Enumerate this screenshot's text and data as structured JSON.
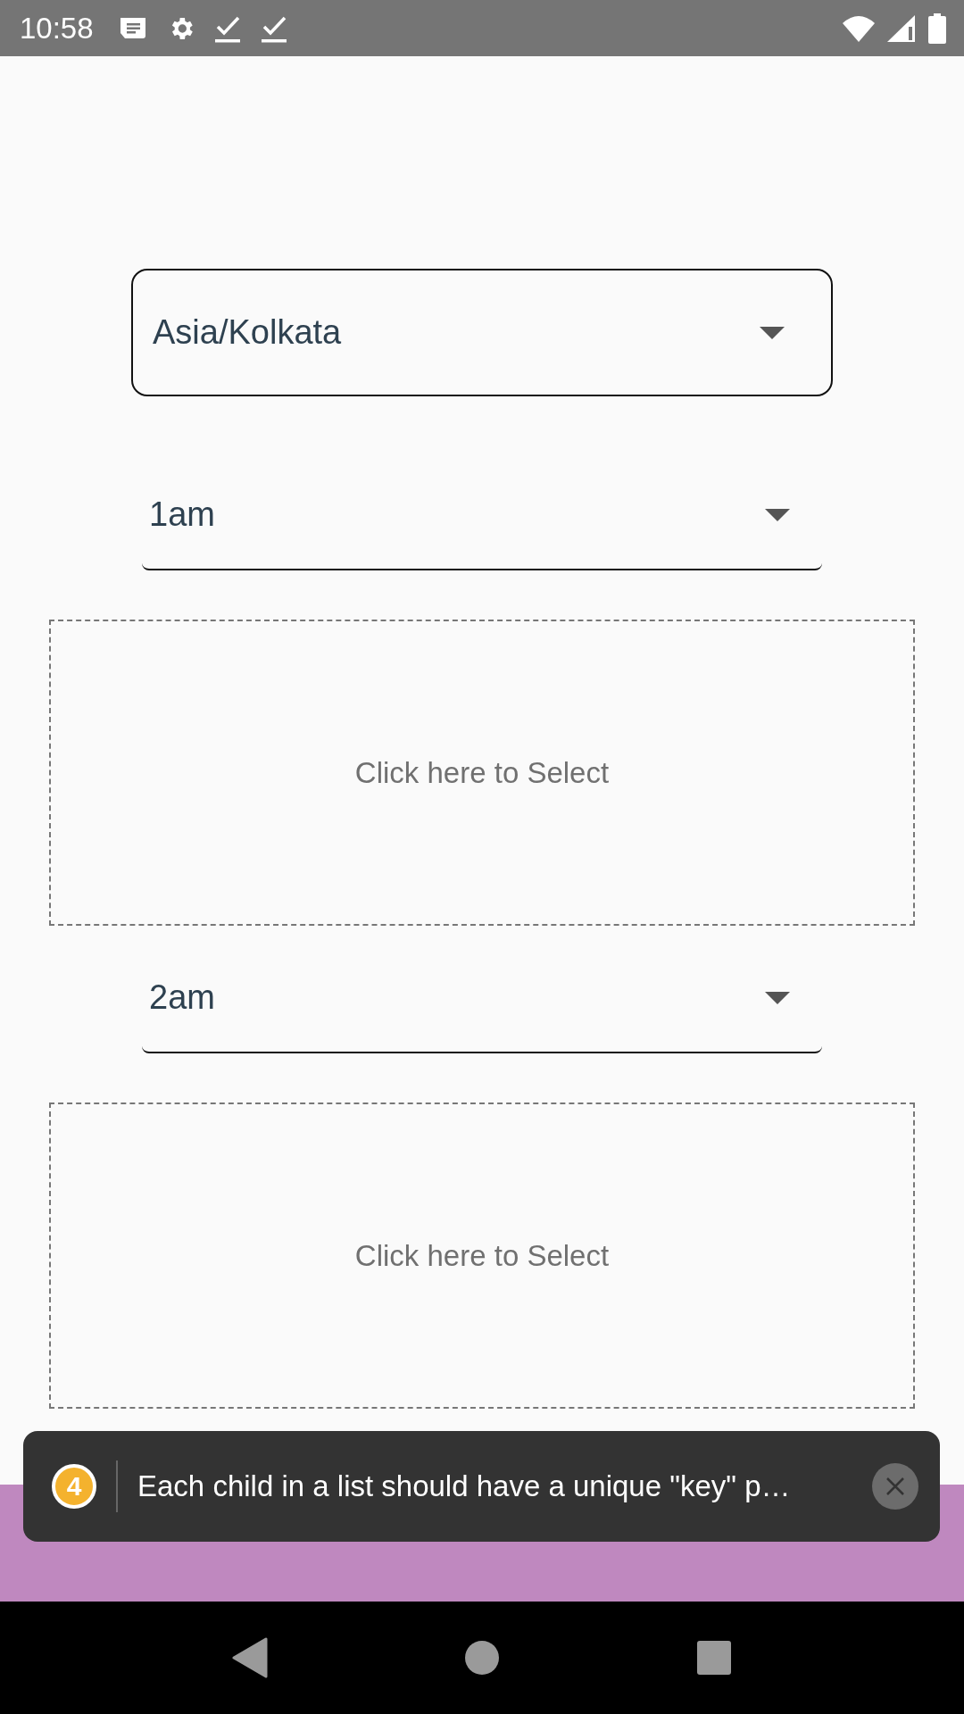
{
  "status_bar": {
    "time": "10:58"
  },
  "timezone_select": {
    "value": "Asia/Kolkata"
  },
  "slots": [
    {
      "time": "1am",
      "prompt": "Click here to Select"
    },
    {
      "time": "2am",
      "prompt": "Click here to Select"
    }
  ],
  "start_button": {
    "kind": "button"
  },
  "toast": {
    "count": "4",
    "message": "Each child in a list should have a unique \"key\" p…"
  }
}
